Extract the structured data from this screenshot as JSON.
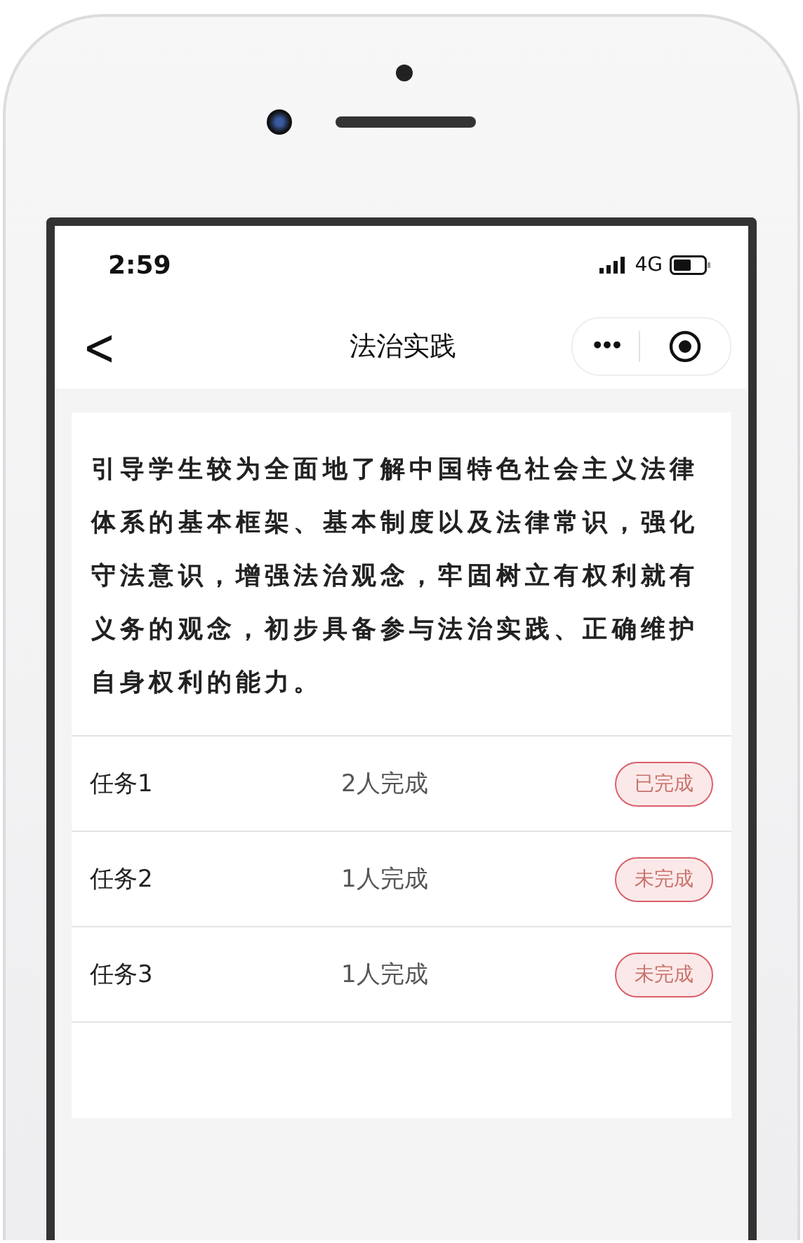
{
  "status_bar": {
    "time": "2:59",
    "network": "4G"
  },
  "nav": {
    "back": "<",
    "title": "法治实践",
    "more": "•••"
  },
  "intro": "引导学生较为全面地了解中国特色社会主义法律体系的基本框架、基本制度以及法律常识，强化守法意识，增强法治观念，牢固树立有权利就有义务的观念，初步具备参与法治实践、正确维护自身权利的能力。",
  "tasks": [
    {
      "name": "任务1",
      "count": "2人完成",
      "status": "已完成"
    },
    {
      "name": "任务2",
      "count": "1人完成",
      "status": "未完成"
    },
    {
      "name": "任务3",
      "count": "1人完成",
      "status": "未完成"
    }
  ]
}
